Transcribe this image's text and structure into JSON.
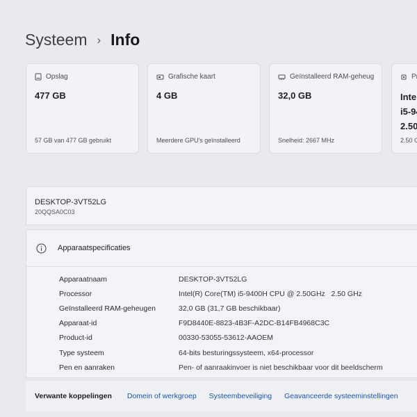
{
  "breadcrumb": {
    "parent": "Systeem",
    "separator": "›",
    "current": "Info"
  },
  "cards": [
    {
      "icon": "storage-icon",
      "title": "Opslag",
      "value": "477 GB",
      "sub": "57 GB van 477 GB gebruikt"
    },
    {
      "icon": "graphics-card-icon",
      "title": "Grafische kaart",
      "value": "4 GB",
      "sub": "Meerdere GPU's geïnstalleerd"
    },
    {
      "icon": "ram-icon",
      "title": "Geïnstalleerd RAM-geheug",
      "value": "32,0 GB",
      "sub": "Snelheid: 2667 MHz"
    },
    {
      "icon": "processor-icon",
      "title": "Pr",
      "value_lines": [
        "Intel",
        "i5-94",
        "2.50"
      ],
      "sub": "2.50 G"
    }
  ],
  "device": {
    "name": "DESKTOP-3VT52LG",
    "model": "20QQSA0C03"
  },
  "specs": {
    "title": "Apparaatspecificaties",
    "rows": [
      {
        "label": "Apparaatnaam",
        "value": "DESKTOP-3VT52LG"
      },
      {
        "label": "Processor",
        "value": "Intel(R) Core(TM) i5-9400H CPU @ 2.50GHz   2.50 GHz"
      },
      {
        "label": "Geïnstalleerd RAM-geheugen",
        "value": "32,0 GB (31,7 GB beschikbaar)"
      },
      {
        "label": "Apparaat-id",
        "value": "F9D8440E-8823-4B3F-A2DC-B14FB4968C3C"
      },
      {
        "label": "Product-id",
        "value": "00330-53055-53612-AAOEM"
      },
      {
        "label": "Type systeem",
        "value": "64-bits besturingssysteem, x64-processor"
      },
      {
        "label": "Pen en aanraken",
        "value": "Pen- of aanraakinvoer is niet beschikbaar voor dit beeldscherm"
      }
    ]
  },
  "related": {
    "label": "Verwante koppelingen",
    "links": [
      "Domein of werkgroep",
      "Systeembeveiliging",
      "Geavanceerde systeeminstellingen"
    ]
  },
  "colors": {
    "background": "#e9eaee",
    "card": "#f2f3f6",
    "link": "#1f55a8"
  }
}
